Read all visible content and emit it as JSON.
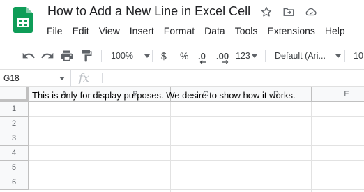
{
  "doc": {
    "title": "How to Add a New Line in Excel Cell",
    "star_icon": "star-icon",
    "move_icon": "move-to-folder-icon",
    "cloud_icon": "cloud-status-icon"
  },
  "menu": [
    "File",
    "Edit",
    "View",
    "Insert",
    "Format",
    "Data",
    "Tools",
    "Extensions",
    "Help"
  ],
  "toolbar": {
    "zoom": "100%",
    "currency": "$",
    "percent": "%",
    "decrease_decimal": ".0",
    "increase_decimal": ".00",
    "number_format": "123",
    "font": "Default (Ari...",
    "font_size": "10"
  },
  "formula_bar": {
    "name_box": "G18",
    "fx": "fx"
  },
  "grid": {
    "columns": [
      "A",
      "B",
      "C",
      "D",
      "E"
    ],
    "rows": [
      "1",
      "2",
      "3",
      "4",
      "5",
      "6"
    ],
    "cell_A1": "This is only for display purposes. We desire to show how it works."
  },
  "colors": {
    "sheets_green": "#0f9d58",
    "header_bg": "#f8f9fa",
    "gridline": "#e2e2e2"
  }
}
